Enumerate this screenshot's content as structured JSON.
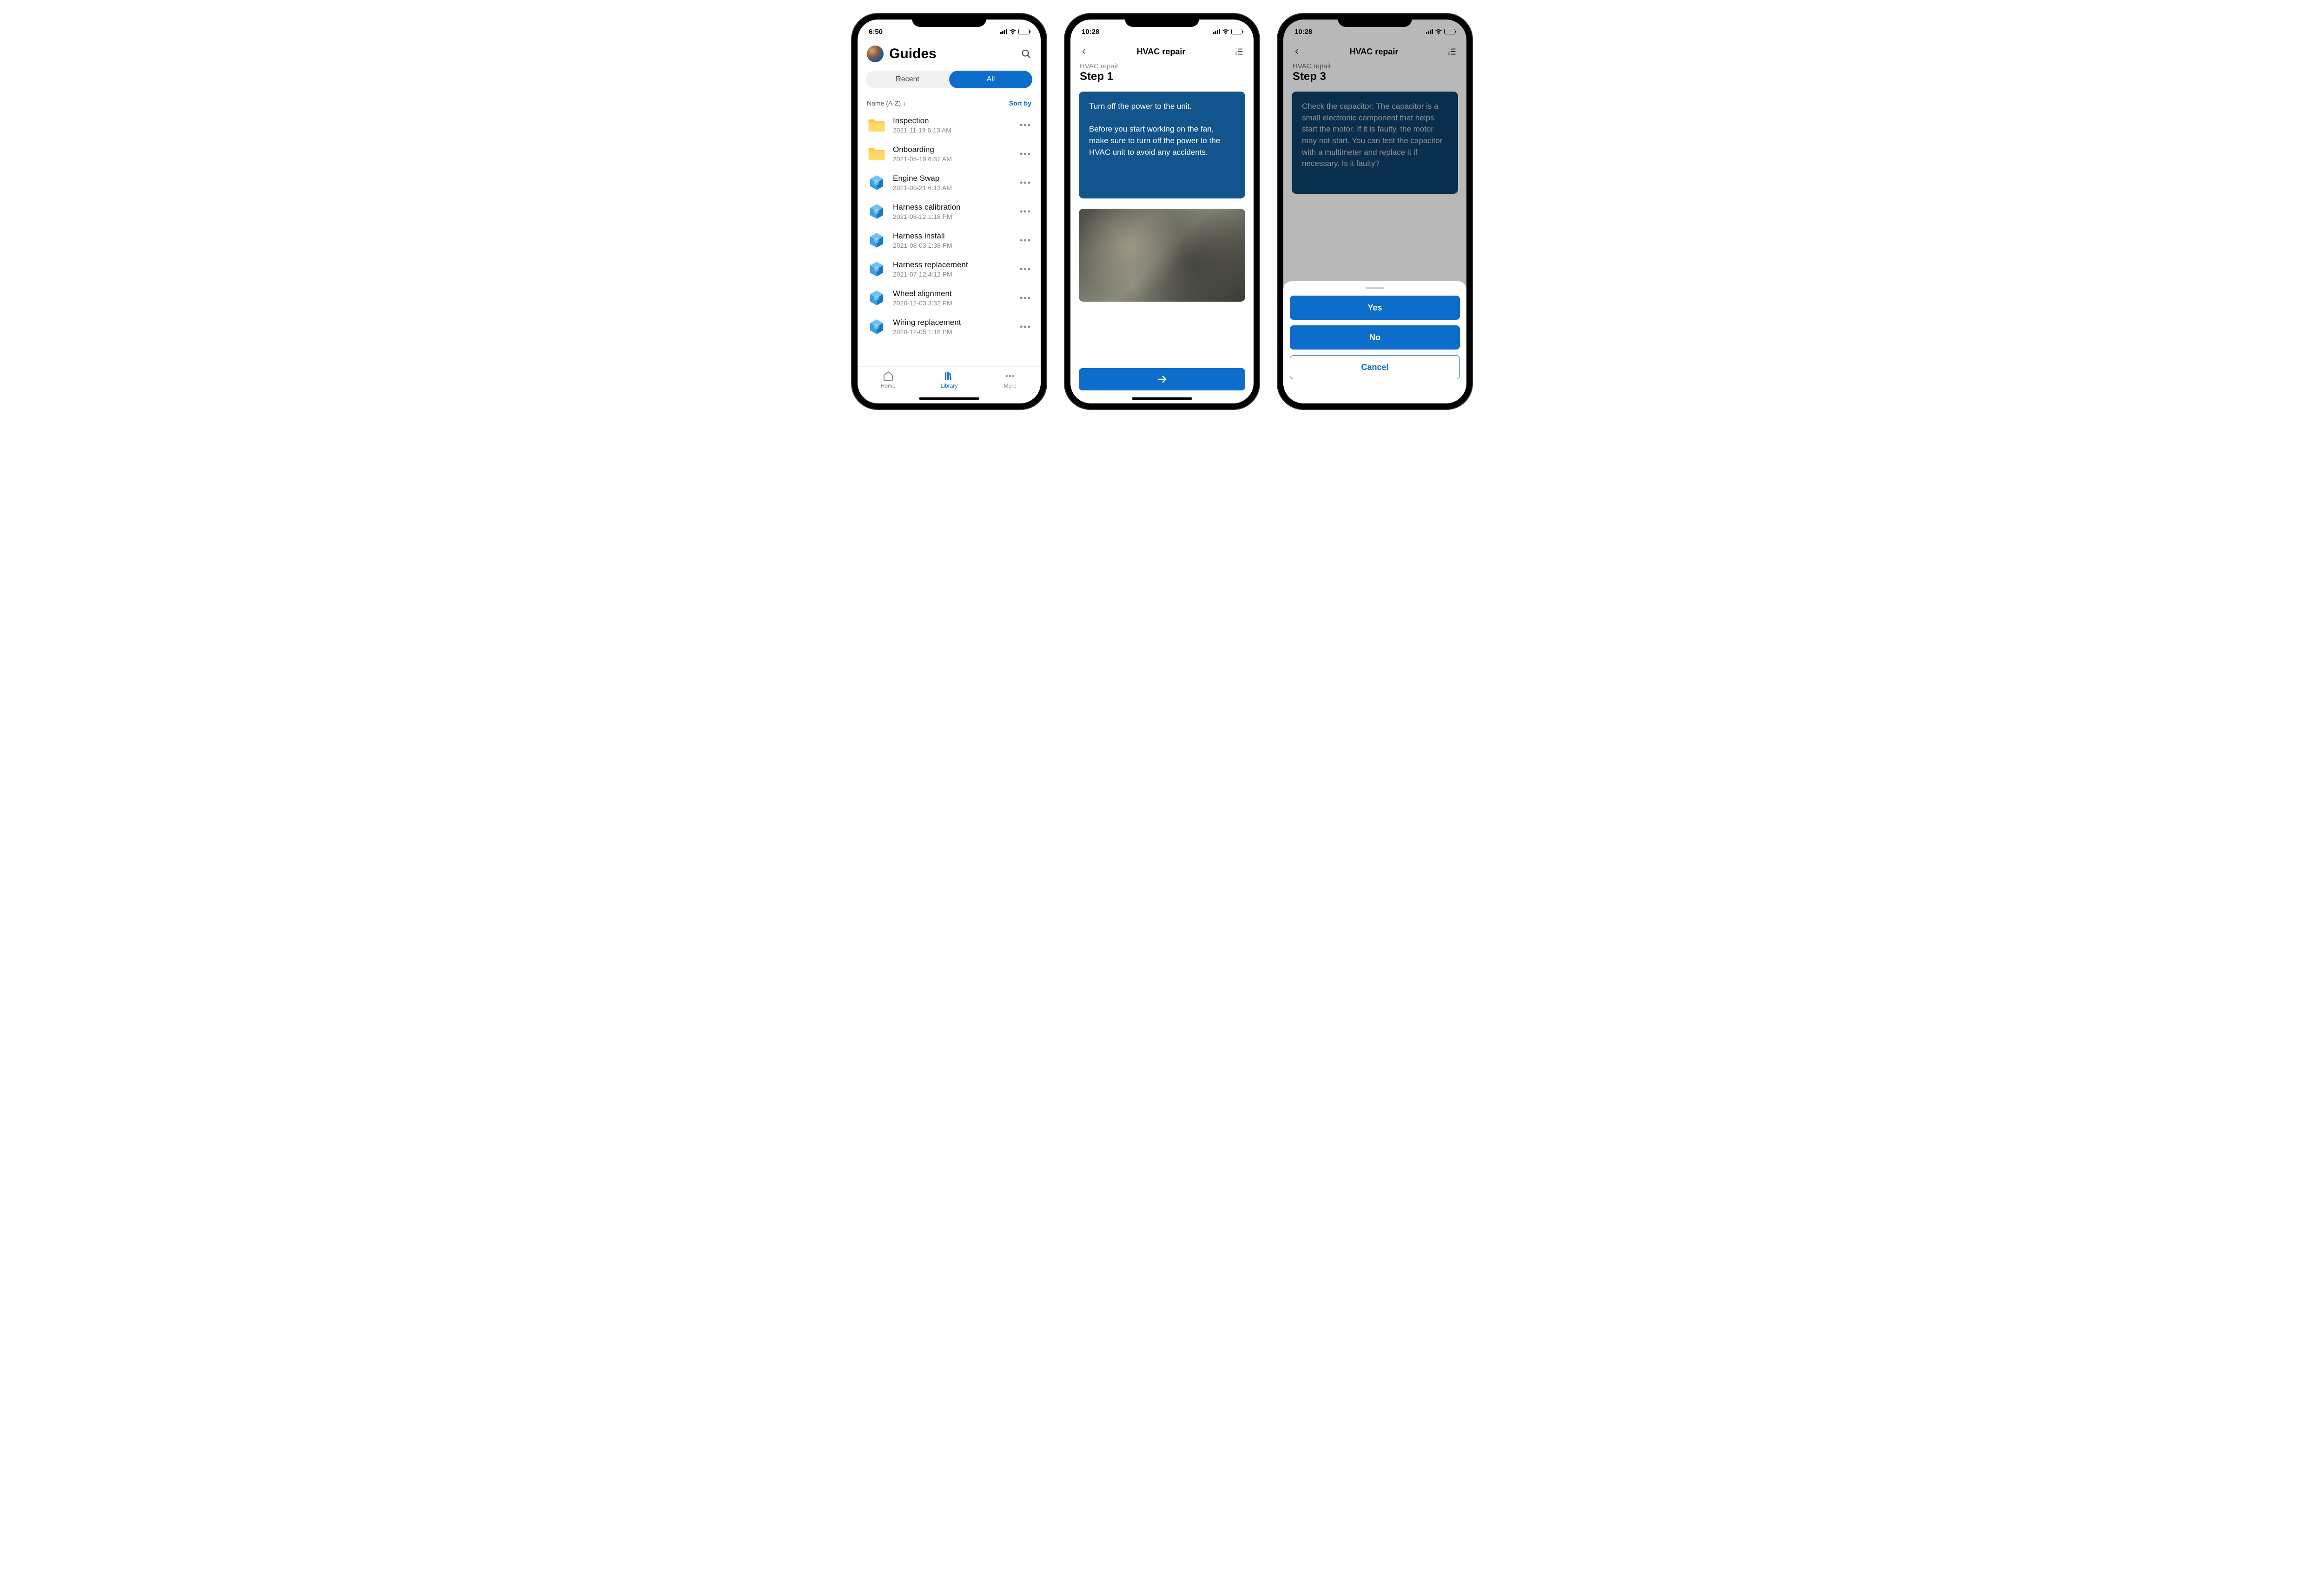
{
  "screen1": {
    "time": "6:50",
    "title": "Guides",
    "segment": {
      "recent": "Recent",
      "all": "All"
    },
    "sort": {
      "label": "Name (A-Z)",
      "direction": "↓",
      "link": "Sort by"
    },
    "items": [
      {
        "type": "folder",
        "name": "Inspection",
        "date": "2021-11-19 6:13 AM"
      },
      {
        "type": "folder",
        "name": "Onboarding",
        "date": "2021-05-19 6:37 AM"
      },
      {
        "type": "guide",
        "name": "Engine Swap",
        "date": "2021-09-21 6:13 AM"
      },
      {
        "type": "guide",
        "name": "Harness calibration",
        "date": "2021-08-12 1:18 PM"
      },
      {
        "type": "guide",
        "name": "Harness install",
        "date": "2021-08-03 1:38 PM"
      },
      {
        "type": "guide",
        "name": "Harness replacement",
        "date": "2021-07-12 4:12 PM"
      },
      {
        "type": "guide",
        "name": "Wheel alignment",
        "date": "2020-12-03 3:32 PM"
      },
      {
        "type": "guide",
        "name": "Wiring replacement",
        "date": "2020-12-05 1:18 PM"
      }
    ],
    "tabs": {
      "home": "Home",
      "library": "Library",
      "more": "More"
    }
  },
  "screen2": {
    "time": "10:28",
    "nav_title": "HVAC repair",
    "breadcrumb": "HVAC repair",
    "step_title": "Step 1",
    "body": "Turn off the power to the unit.\n\nBefore you start working on the fan, make sure to turn off the power to the HVAC unit to avoid any accidents."
  },
  "screen3": {
    "time": "10:28",
    "nav_title": "HVAC repair",
    "breadcrumb": "HVAC repair",
    "step_title": "Step 3",
    "body": "Check the capacitor: The capacitor is a small electronic component that helps start the motor. If it is faulty, the motor may not start. You can test the capacitor with a multimeter and replace it if necessary.\n\nIs it faulty?",
    "sheet": {
      "yes": "Yes",
      "no": "No",
      "cancel": "Cancel"
    }
  },
  "colors": {
    "primary": "#0c6dca",
    "card": "#12548c"
  }
}
